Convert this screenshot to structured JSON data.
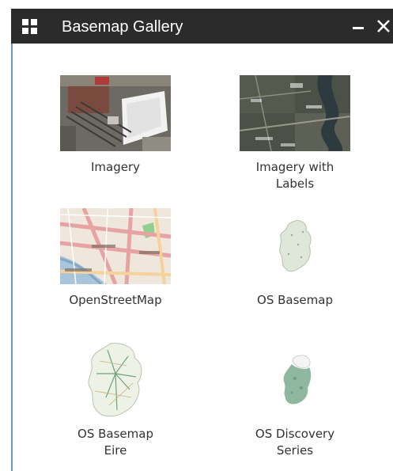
{
  "window": {
    "title": "Basemap Gallery",
    "header_color": "#2b2b2b",
    "minimize_icon": "minimize-icon",
    "close_icon": "close-icon"
  },
  "basemaps": [
    {
      "label": "Imagery",
      "thumbnail": "aerial-imagery-thumbnail"
    },
    {
      "label": "Imagery with\nLabels",
      "thumbnail": "labelled-imagery-thumbnail"
    },
    {
      "label": "OpenStreetMap",
      "thumbnail": "street-map-thumbnail"
    },
    {
      "label": "OS Basemap",
      "thumbnail": "ireland-outline-thumbnail"
    },
    {
      "label": "OS Basemap\nEire",
      "thumbnail": "ireland-roads-thumbnail"
    },
    {
      "label": "OS Discovery\nSeries",
      "thumbnail": "ireland-discovery-thumbnail"
    }
  ]
}
